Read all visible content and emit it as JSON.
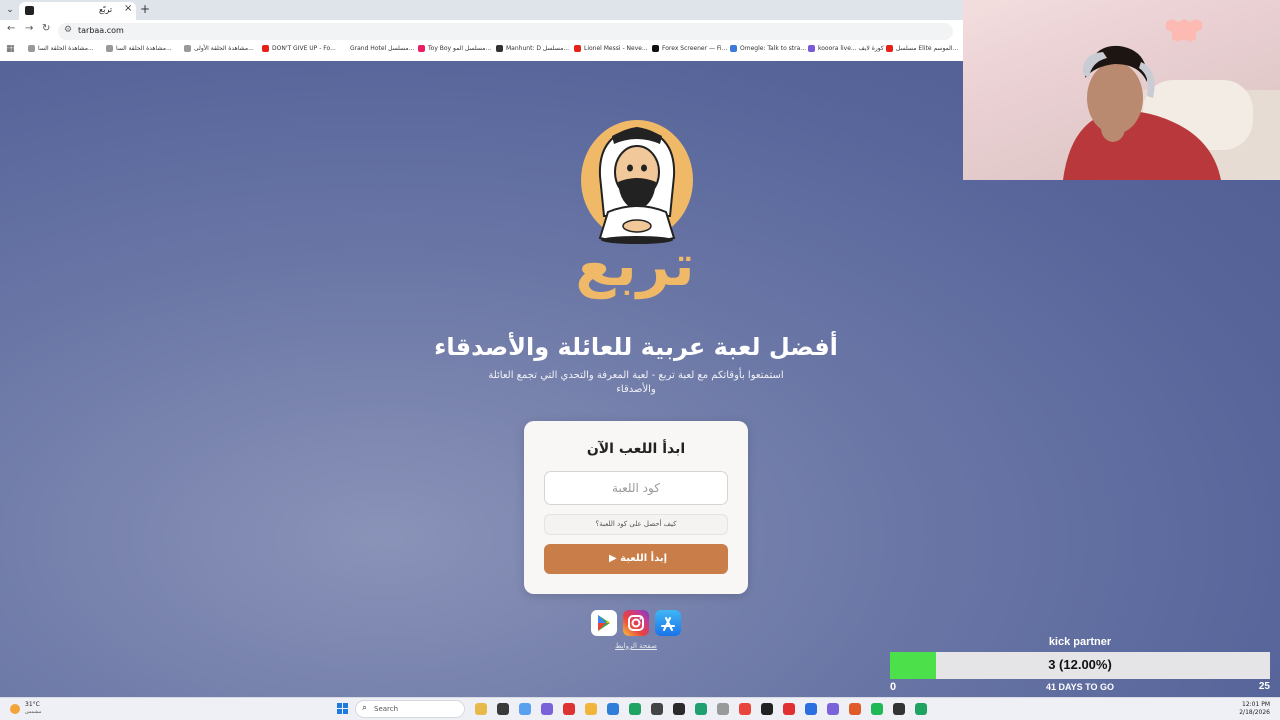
{
  "browser": {
    "tab_title": "تربّع",
    "url": "tarbaa.com",
    "new_tab_symbol": "+",
    "close_symbol": "×",
    "bookmarks": [
      {
        "label": "مشاهدة الحلقة السا...",
        "color": "#999999"
      },
      {
        "label": "مشاهدة الحلقة السا...",
        "color": "#999999"
      },
      {
        "label": "مشاهدة الحلقة الأولى...",
        "color": "#999999"
      },
      {
        "label": "DON'T GIVE UP - Fo...",
        "color": "#e62117"
      },
      {
        "label": "Grand Hotel مسلسل...",
        "color": "#ffffff"
      },
      {
        "label": "Toy Boy مسلسل المو...",
        "color": "#e91e63"
      },
      {
        "label": "Manhunt: D مسلسل...",
        "color": "#333333"
      },
      {
        "label": "Lionel Messi - Neve...",
        "color": "#e62117"
      },
      {
        "label": "Forex Screener — Fi...",
        "color": "#111111"
      },
      {
        "label": "Omegle: Talk to stra...",
        "color": "#3f7ad8"
      },
      {
        "label": "kooora live... كورة لايف",
        "color": "#7a5ad8"
      },
      {
        "label": "مسلسل Elite الموسم...",
        "color": "#e62117"
      }
    ]
  },
  "page": {
    "logo_text": "تربع",
    "headline": "أفضل لعبة عربية للعائلة والأصدقاء",
    "subline": "استمتعوا بأوقاتكم مع لعبة تربع - لعبة المعرفة والتحدي التي تجمع العائلة والأصدقاء",
    "card": {
      "title": "ابدأ اللعب الآن",
      "code_placeholder": "كود اللعبة",
      "help_text": "كيف أحصل على كود اللعبة؟",
      "start_label": "إبدأ اللعبة",
      "start_icon": "▶"
    },
    "stores": [
      {
        "name": "google-play-icon"
      },
      {
        "name": "instagram-icon"
      },
      {
        "name": "app-store-icon"
      }
    ],
    "footer_link": "صفحة الروابط",
    "colors": {
      "accent": "#c97d48",
      "logo": "#f0b968"
    }
  },
  "kick_widget": {
    "title": "kick partner",
    "count_text": "3 (12.00%)",
    "progress": 0.12,
    "min": "0",
    "max": "25",
    "days_text": "41 DAYS TO GO"
  },
  "taskbar": {
    "weather_temp": "31°C",
    "weather_cond": "مشمس",
    "search_label": "Search",
    "time": "12:01 PM",
    "date": "2/18/2026"
  }
}
